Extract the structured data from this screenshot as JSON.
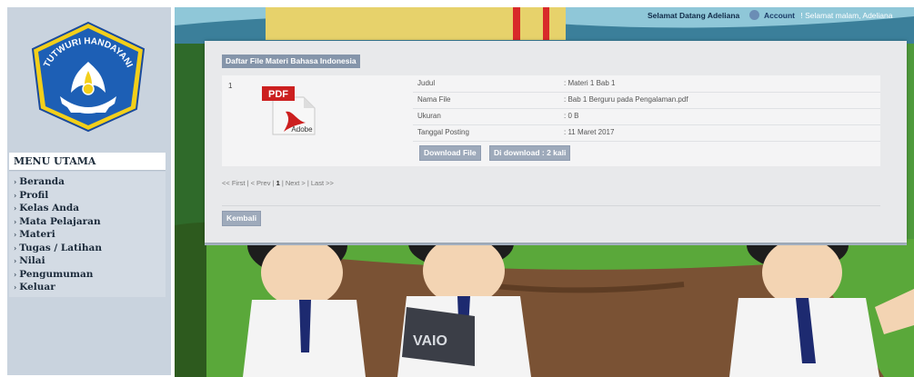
{
  "colors": {
    "sidebar_bg": "#c9d3de",
    "panel_bg": "#e8e9eb",
    "button_bg": "#9eaabb",
    "heading_bg": "#8595aa",
    "pdf_red": "#cc1f1f"
  },
  "logo": {
    "arc_text": "TUTWURI HANDAYANI",
    "icon": "tut-wuri-handayani-emblem"
  },
  "sidebar": {
    "title": "MENU UTAMA",
    "items": [
      {
        "label": "Beranda"
      },
      {
        "label": "Profil"
      },
      {
        "label": "Kelas Anda"
      },
      {
        "label": "Mata Pelajaran"
      },
      {
        "label": "Materi"
      },
      {
        "label": "Tugas / Latihan"
      },
      {
        "label": "Nilai"
      },
      {
        "label": "Pengumuman"
      },
      {
        "label": "Keluar"
      }
    ]
  },
  "header": {
    "greeting": "Selamat Datang Adeliana",
    "account_label": "Account",
    "time_greeting": "! Selamat malam, Adeliana"
  },
  "main": {
    "heading": "Daftar File Materi Bahasa Indonesia",
    "file": {
      "number": "1",
      "icon_pdf_label": "PDF",
      "icon_brand_label": "Adobe",
      "rows": [
        {
          "label": "Judul",
          "value": ": Materi 1 Bab 1"
        },
        {
          "label": "Nama File",
          "value": ": Bab 1 Berguru pada Pengalaman.pdf"
        },
        {
          "label": "Ukuran",
          "value": ": 0 B"
        },
        {
          "label": "Tanggal Posting",
          "value": ": 11 Maret 2017"
        }
      ],
      "download_label": "Download File",
      "download_count_label": "Di download : 2 kali"
    },
    "pagination": {
      "first": "<< First",
      "prev": "< Prev",
      "current": "1",
      "next": "Next >",
      "last": "Last >>",
      "sep": " | "
    },
    "back_label": "Kembali"
  },
  "background": {
    "laptop_brand": "VAIO"
  }
}
